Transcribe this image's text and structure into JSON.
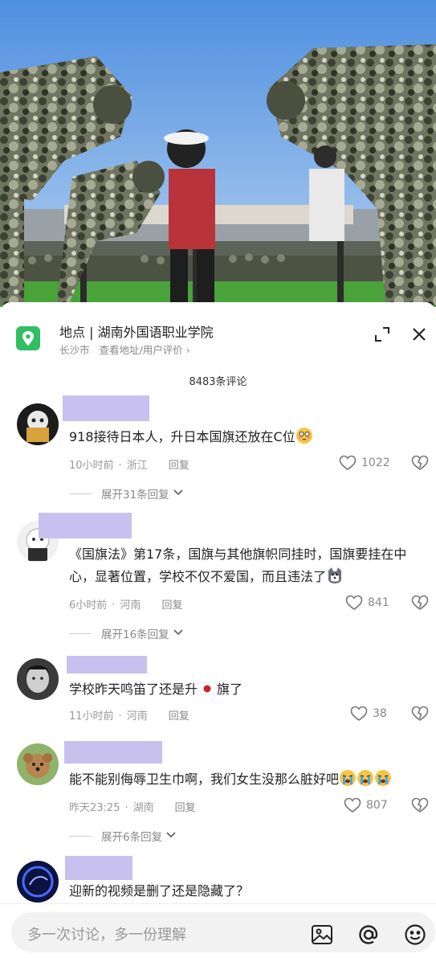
{
  "location": {
    "title": "地点 | 湖南外国语职业学院",
    "city": "长沙市",
    "link": "查看地址/用户评价 ›"
  },
  "comment_count": "8483条评论",
  "comments": [
    {
      "text": "918接待日本人，升日本国旗还放在C位",
      "time": "10小时前",
      "region": "浙江",
      "reply": "回复",
      "likes": "1022",
      "expand": "展开31条回复"
    },
    {
      "text": "《国旗法》第17条，国旗与其他旗帜同挂时，国旗要挂在中心，显著位置，学校不仅不爱国，而且违法了",
      "time": "6小时前",
      "region": "河南",
      "reply": "回复",
      "likes": "841",
      "expand": "展开16条回复"
    },
    {
      "text_before": "学校昨天鸣笛了还是升",
      "text_after": "旗了",
      "time": "11小时前",
      "region": "河南",
      "reply": "回复",
      "likes": "38"
    },
    {
      "text": "能不能别侮辱卫生巾啊，我们女生没那么脏好吧",
      "time": "昨天23:25",
      "region": "湖南",
      "reply": "回复",
      "likes": "807",
      "expand": "展开6条回复"
    },
    {
      "text": "迎新的视频是删了还是隐藏了？"
    }
  ],
  "input": {
    "placeholder": "多一次讨论，多一份理解"
  },
  "icons": {
    "location": "location-pin-icon",
    "expand": "expand-icon",
    "close": "close-icon",
    "like": "heart-icon",
    "dislike": "broken-heart-icon",
    "image": "image-icon",
    "mention": "at-icon",
    "emoji": "emoji-icon"
  },
  "colors": {
    "location_badge": "#2fbf62",
    "name_redaction": "#c8c0ee",
    "sky": "#6fa3e0"
  }
}
